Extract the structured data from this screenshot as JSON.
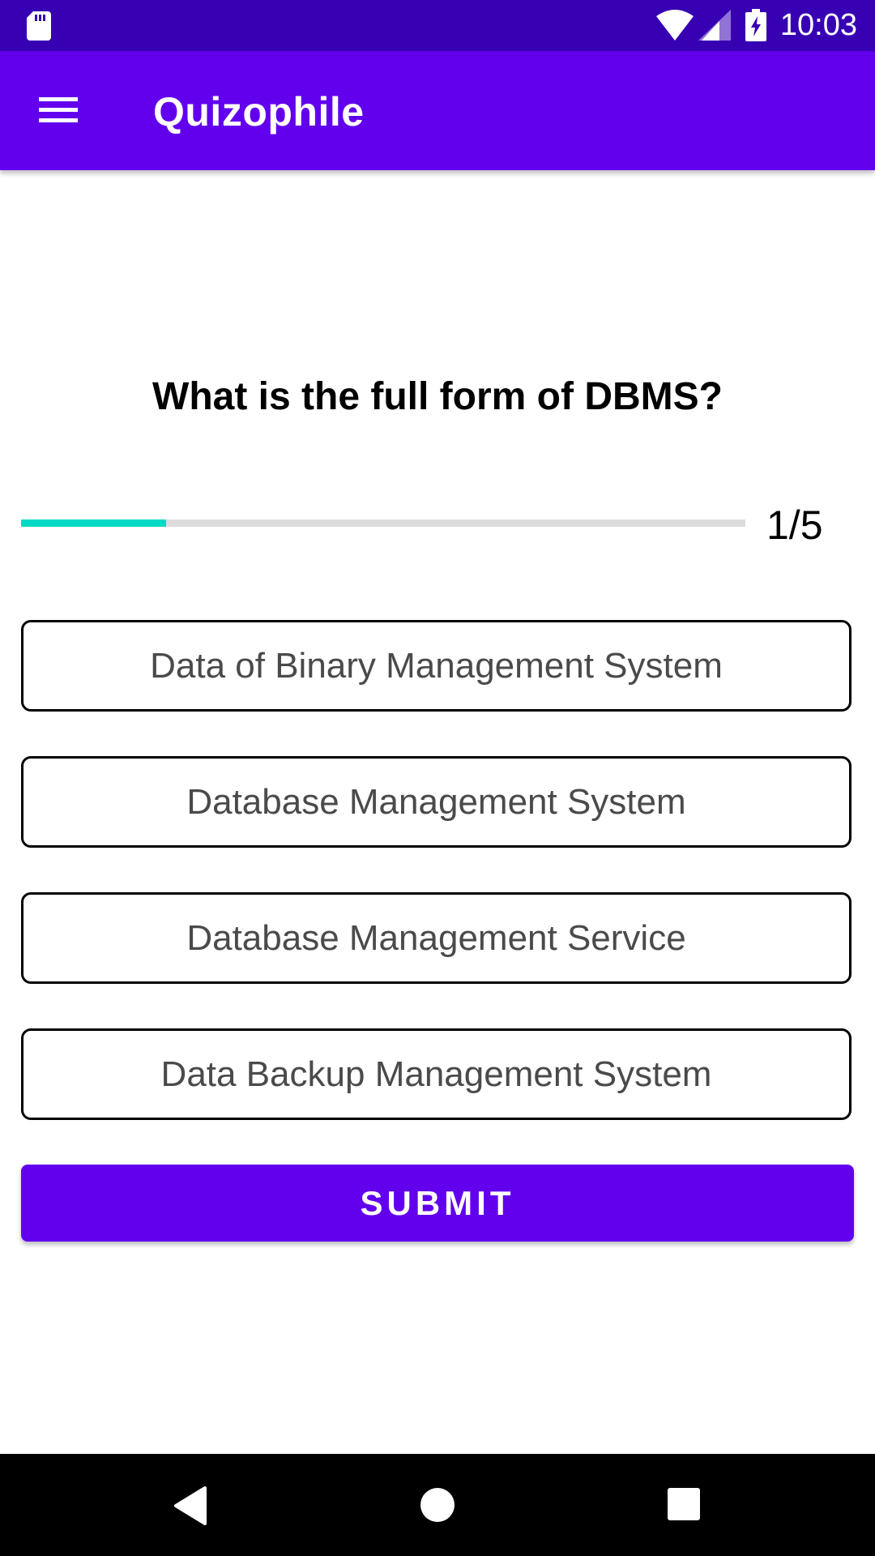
{
  "status_bar": {
    "time": "10:03",
    "icons": [
      "sd-card-icon",
      "wifi-icon",
      "cell-signal-icon",
      "battery-charging-icon"
    ]
  },
  "app_bar": {
    "title": "Quizophile",
    "menu_icon": "hamburger-menu-icon"
  },
  "quiz": {
    "question": "What is the full form of DBMS?",
    "progress": {
      "current": 1,
      "total": 5,
      "label": "1/5",
      "fraction": 0.2
    },
    "options": [
      {
        "label": "Data of Binary Management System"
      },
      {
        "label": "Database Management System"
      },
      {
        "label": "Database Management Service"
      },
      {
        "label": "Data Backup Management System"
      }
    ],
    "submit_label": "SUBMIT"
  },
  "nav_bar": {
    "icons": [
      "back-icon",
      "home-icon",
      "recents-icon"
    ]
  },
  "colors": {
    "status_bar": "#3700b3",
    "primary": "#6200ee",
    "progress_fill": "#03dac5",
    "progress_track": "#dcdcdc",
    "option_border": "#000000",
    "option_text": "#4a4a4a"
  }
}
